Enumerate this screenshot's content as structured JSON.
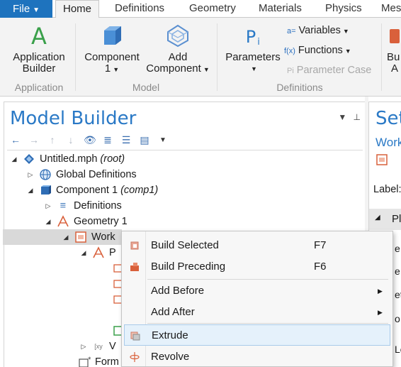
{
  "ribbon_tabs": {
    "file": "File",
    "tabs": [
      "Home",
      "Definitions",
      "Geometry",
      "Materials",
      "Physics",
      "Mes"
    ]
  },
  "ribbon": {
    "application": {
      "application_builder": [
        "Application",
        "Builder"
      ],
      "group_label": "Application"
    },
    "model": {
      "component": [
        "Component",
        "1"
      ],
      "add_component": [
        "Add",
        "Component"
      ],
      "group_label": "Model"
    },
    "definitions": {
      "parameters": "Parameters",
      "variables": "Variables",
      "functions": "Functions",
      "parameter_case": "Parameter Case",
      "group_label": "Definitions"
    },
    "partial": [
      "Bu",
      "A"
    ]
  },
  "model_builder": {
    "title": "Model Builder",
    "tree": {
      "root": {
        "label": "Untitled.mph",
        "tag": "(root)"
      },
      "global_definitions": "Global Definitions",
      "component": {
        "label": "Component 1",
        "tag": "(comp1)"
      },
      "definitions": "Definitions",
      "geometry": "Geometry 1",
      "work_plane": "Work",
      "plane_geometry": "P",
      "view_label": "V",
      "form_label": "Form"
    }
  },
  "settings_panel": {
    "title": "Set",
    "subtitle": "Work",
    "label_prefix": "Label:",
    "section": "Pl",
    "row_letters": [
      "e",
      "e:",
      "et",
      "o",
      "Lo"
    ]
  },
  "context_menu": {
    "items": [
      {
        "label": "Build Selected",
        "shortcut": "F7"
      },
      {
        "label": "Build Preceding",
        "shortcut": "F6"
      },
      {
        "label": "Add Before",
        "submenu": true
      },
      {
        "label": "Add After",
        "submenu": true
      },
      {
        "label": "Extrude",
        "hovered": true
      },
      {
        "label": "Revolve"
      }
    ]
  },
  "colors": {
    "accent_blue": "#1e73be",
    "title_blue": "#2a79c6",
    "menu_hover": "#e5f1fb"
  }
}
